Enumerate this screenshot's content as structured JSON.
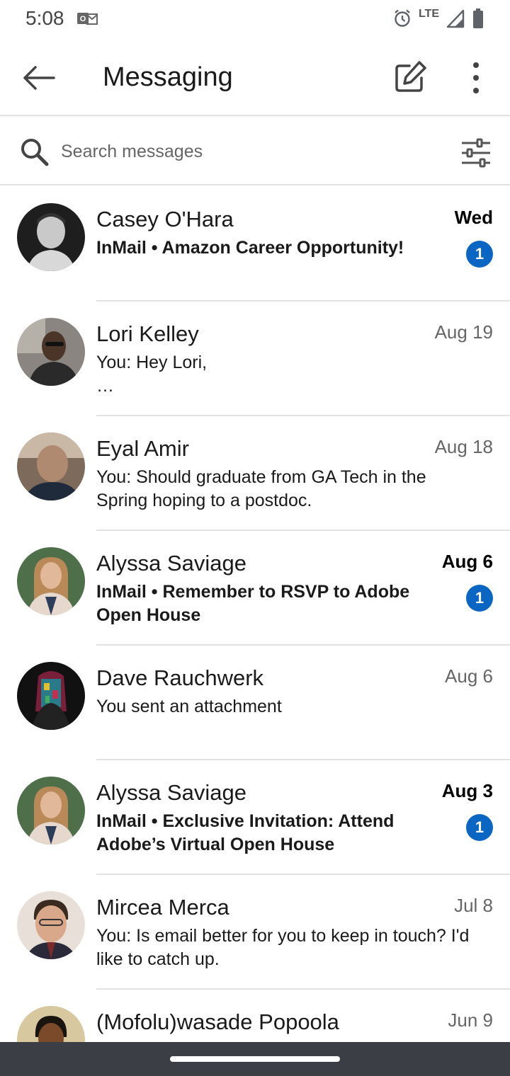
{
  "status_bar": {
    "time": "5:08",
    "network": "LTE"
  },
  "app_bar": {
    "title": "Messaging"
  },
  "search": {
    "placeholder": "Search messages"
  },
  "colors": {
    "accent": "#0a66c2",
    "divider": "#e2e2e2",
    "nav_bar": "#3b3f45"
  },
  "conversations": [
    {
      "name": "Casey O'Hara",
      "date": "Wed",
      "snippet": "InMail • Amazon Career Opportunity!",
      "unread": true,
      "badge": "1"
    },
    {
      "name": "Lori Kelley",
      "date": "Aug 19",
      "snippet": "You: Hey Lori,\n…",
      "unread": false
    },
    {
      "name": "Eyal Amir",
      "date": "Aug 18",
      "snippet": "You: Should graduate from GA Tech in the Spring hoping to a postdoc.",
      "unread": false
    },
    {
      "name": "Alyssa Saviage",
      "date": "Aug 6",
      "snippet": "InMail • Remember to RSVP to Adobe Open House",
      "unread": true,
      "badge": "1"
    },
    {
      "name": "Dave Rauchwerk",
      "date": "Aug 6",
      "snippet": "You sent an attachment",
      "unread": false
    },
    {
      "name": "Alyssa Saviage",
      "date": "Aug 3",
      "snippet": "InMail • Exclusive Invitation: Attend Adobe’s Virtual Open House",
      "unread": true,
      "badge": "1"
    },
    {
      "name": "Mircea Merca",
      "date": "Jul 8",
      "snippet": "You: Is email better for you to keep in touch? I'd like to catch up.",
      "unread": false
    },
    {
      "name": "(Mofolu)wasade Popoola",
      "date": "Jun 9",
      "snippet": "",
      "unread": false
    }
  ]
}
